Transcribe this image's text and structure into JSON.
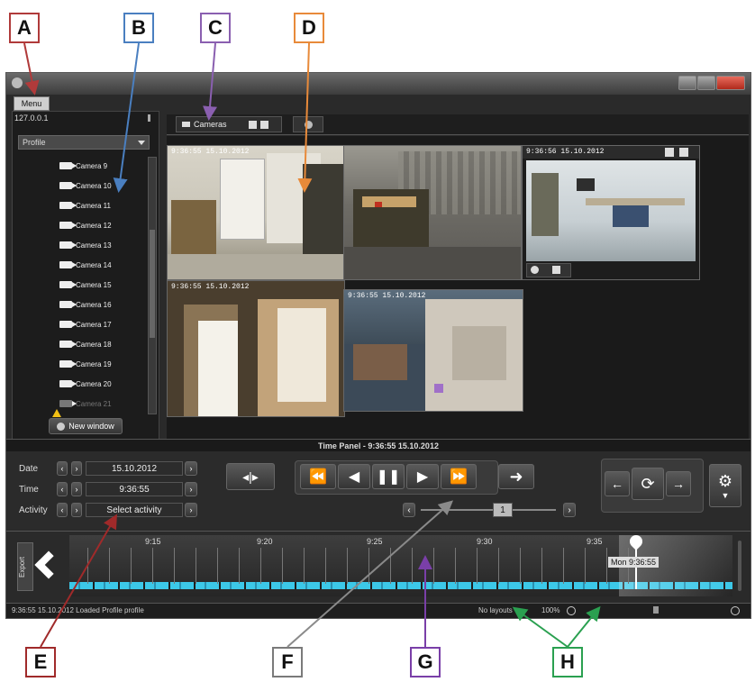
{
  "callouts": [
    "A",
    "B",
    "C",
    "D",
    "E",
    "F",
    "G",
    "H"
  ],
  "colors": {
    "A": "#b03a3a",
    "B": "#4a7fc0",
    "C": "#8a5fb0",
    "D": "#e88a3a",
    "E": "#a02a2a",
    "F": "#7a7a7a",
    "G": "#7a3fa8",
    "H": "#2aa050"
  },
  "app": {
    "menu_label": "Menu",
    "server_address": "127.0.0.1",
    "profile_select": "Profile",
    "new_window_label": "New window",
    "tabs": [
      {
        "label": "Cameras"
      }
    ]
  },
  "camera_list": [
    "Camera 9",
    "Camera 10",
    "Camera 11",
    "Camera 12",
    "Camera 13",
    "Camera 14",
    "Camera 15",
    "Camera 16",
    "Camera 17",
    "Camera 18",
    "Camera 19",
    "Camera 20",
    "Camera 21"
  ],
  "video": {
    "timestamp_tl": "9:36:55 15.10.2012",
    "timestamp_tr": "9:36:56 15.10.2012",
    "timestamp_bl": "9:36:55 15.10.2012",
    "timestamp_bc": "9:36:55 15.10.2012"
  },
  "time_panel": {
    "title": "Time Panel - 9:36:55 15.10.2012",
    "date_label": "Date",
    "date_value": "15.10.2012",
    "time_label": "Time",
    "time_value": "9:36:55",
    "activity_label": "Activity",
    "activity_value": "Select activity",
    "speed_value": "1"
  },
  "timeline": {
    "export_label": "Export",
    "ticks": [
      "9:15",
      "9:20",
      "9:25",
      "9:30",
      "9:35"
    ],
    "cursor_label": "Mon 9:36:55"
  },
  "status_bar": {
    "left_text": "9:36:55 15.10.2012 Loaded Profile profile",
    "layouts": "No layouts",
    "zoom": "100%"
  }
}
